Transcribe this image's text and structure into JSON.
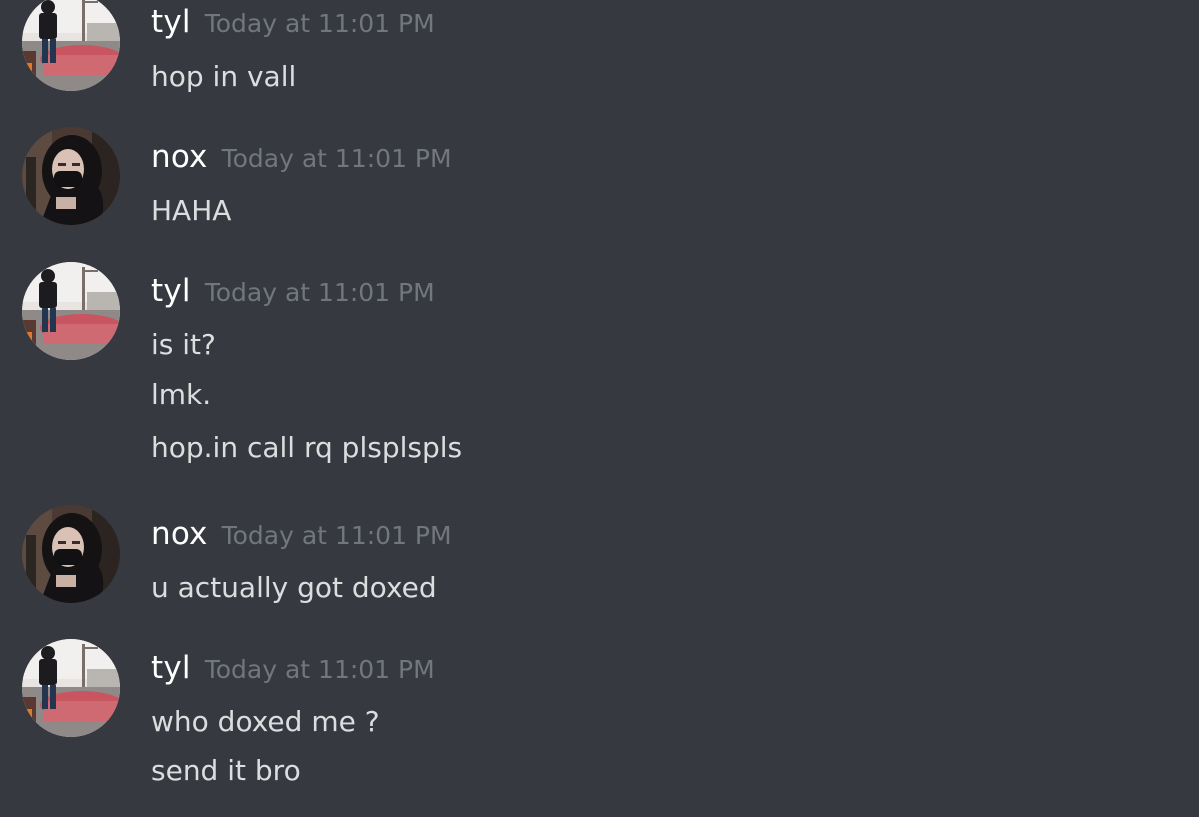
{
  "colors": {
    "background": "#36393f",
    "username": "#ffffff",
    "timestamp": "#72767d",
    "message_text": "#dcddde"
  },
  "messages": [
    {
      "author": "tyl",
      "avatar": "tyl-avatar-icon",
      "timestamp": "Today at 11:01 PM",
      "lines": [
        "hop in vall"
      ]
    },
    {
      "author": "nox",
      "avatar": "nox-avatar-icon",
      "timestamp": "Today at 11:01 PM",
      "lines": [
        "HAHA"
      ]
    },
    {
      "author": "tyl",
      "avatar": "tyl-avatar-icon",
      "timestamp": "Today at 11:01 PM",
      "lines": [
        "is it?",
        "lmk.",
        "hop.in call rq plsplspls"
      ]
    },
    {
      "author": "nox",
      "avatar": "nox-avatar-icon",
      "timestamp": "Today at 11:01 PM",
      "lines": [
        "u actually got doxed"
      ]
    },
    {
      "author": "tyl",
      "avatar": "tyl-avatar-icon",
      "timestamp": "Today at 11:01 PM",
      "lines": [
        "who doxed me ?",
        "send it bro"
      ]
    }
  ]
}
